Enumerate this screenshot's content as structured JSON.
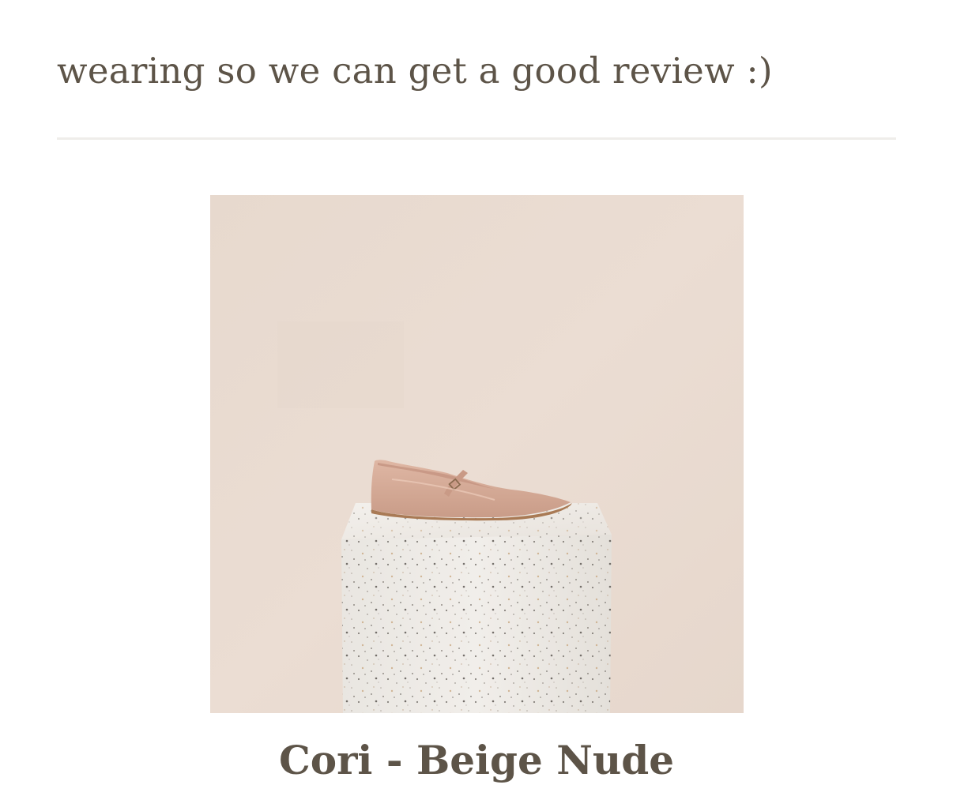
{
  "intro": {
    "line_partial": "wearing so we can get a good review :)"
  },
  "product": {
    "title": "Cori - Beige Nude",
    "image_icon": "shoe-on-terrazzo-pedestal",
    "colors": {
      "backdrop": "#eadcd2",
      "shoe": "#d7ab98",
      "pedestal": "#eeebe6",
      "text": "#5d5448"
    }
  }
}
